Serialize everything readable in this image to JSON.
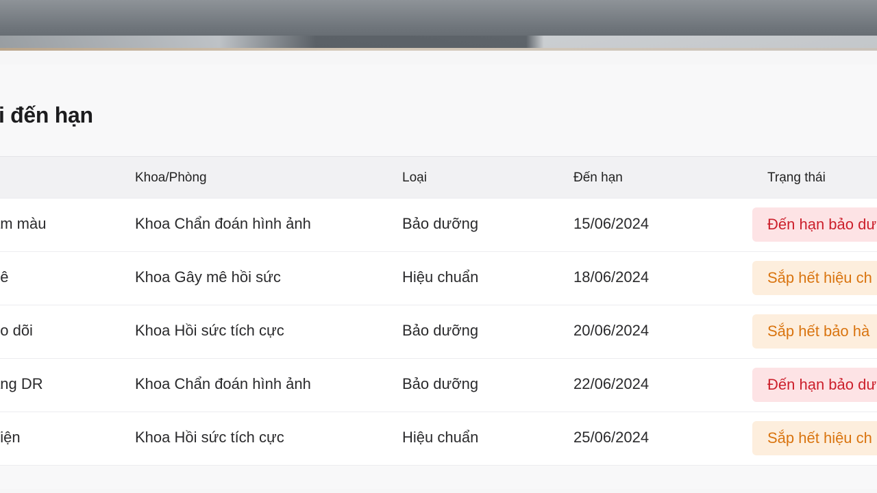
{
  "page_title": "i đến hạn",
  "table": {
    "headers": [
      "Khoa/Phòng",
      "Loại",
      "Đến hạn",
      "Trạng thái"
    ],
    "rows": [
      {
        "name": "am màu",
        "department": "Khoa Chẩn đoán hình ảnh",
        "type": "Bảo dưỡng",
        "due": "15/06/2024",
        "status": "Đến hạn bảo dư",
        "status_color": "#cc1f2b",
        "status_bg": "#fde3e5"
      },
      {
        "name": "nê",
        "department": "Khoa Gây mê hồi sức",
        "type": "Hiệu chuẩn",
        "due": "18/06/2024",
        "status": "Sắp hết hiệu ch",
        "status_color": "#d9740f",
        "status_bg": "#fdeedd"
      },
      {
        "name": "eo dõi",
        "department": "Khoa Hồi sức tích cực",
        "type": "Bảo dưỡng",
        "due": "20/06/2024",
        "status": "Sắp hết bảo hà",
        "status_color": "#d9740f",
        "status_bg": "#fdeedd"
      },
      {
        "name": "ang DR",
        "department": "Khoa Chẩn đoán hình ảnh",
        "type": "Bảo dưỡng",
        "due": "22/06/2024",
        "status": "Đến hạn bảo dư",
        "status_color": "#cc1f2b",
        "status_bg": "#fde3e5"
      },
      {
        "name": "điện",
        "department": "Khoa Hồi sức tích cực",
        "type": "Hiệu chuẩn",
        "due": "25/06/2024",
        "status": "Sắp hết hiệu ch",
        "status_color": "#d9740f",
        "status_bg": "#fdeedd"
      }
    ]
  }
}
